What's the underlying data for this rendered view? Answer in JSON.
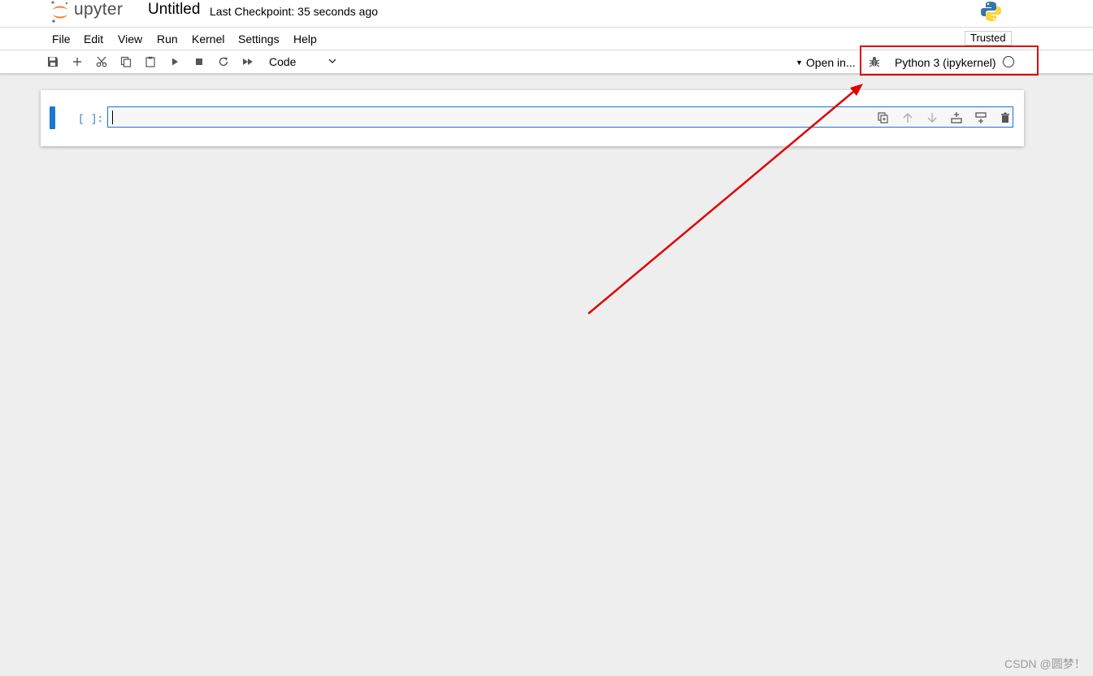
{
  "header": {
    "logo_text": "upyter",
    "notebook_title": "Untitled",
    "checkpoint": "Last Checkpoint: 35 seconds ago",
    "logo_icon": "jupyter-logo",
    "kernel_logo_icon": "python-logo"
  },
  "menubar": {
    "items": [
      "File",
      "Edit",
      "View",
      "Run",
      "Kernel",
      "Settings",
      "Help"
    ],
    "trusted": "Trusted"
  },
  "toolbar": {
    "buttons": [
      "save-icon",
      "add-icon",
      "cut-icon",
      "copy-icon",
      "paste-icon",
      "run-icon",
      "stop-icon",
      "restart-icon",
      "fast-forward-icon"
    ],
    "cell_type": "Code",
    "open_in": "Open in...",
    "kernel_name": "Python 3 (ipykernel)",
    "kernel_status": "idle"
  },
  "cell": {
    "prompt": "[ ]:",
    "content": "",
    "tools": [
      "duplicate-icon",
      "move-up-icon",
      "move-down-icon",
      "insert-above-icon",
      "insert-below-icon",
      "delete-icon"
    ]
  },
  "annotation": {
    "color": "#e00000"
  },
  "colors": {
    "accent": "#1976d2",
    "prompt": "#307fc1",
    "jupyter_orange": "#f37726"
  },
  "watermark": "CSDN @圆梦！"
}
